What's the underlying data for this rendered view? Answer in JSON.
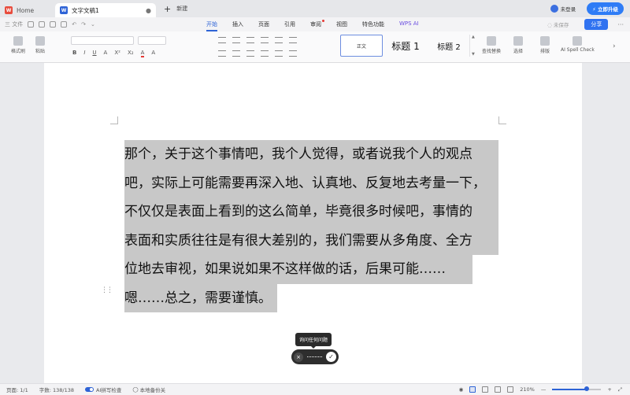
{
  "titlebar": {
    "home_tab": "Home",
    "doc_tab": "文字文稿1",
    "new_tab": "新建",
    "login": "未登录",
    "upgrade": "立即升级"
  },
  "menubar": {
    "quick_file": "三 文件",
    "menus": [
      "开始",
      "插入",
      "页面",
      "引用",
      "审阅",
      "视图",
      "特色功能",
      "WPS AI"
    ],
    "active_menu": "开始",
    "unsaved": "未保存",
    "share": "分享",
    "more": "···"
  },
  "ribbon": {
    "format_painter": "格式刷",
    "paste": "粘贴",
    "format_buttons": [
      "B",
      "I",
      "U",
      "A",
      "X²",
      "X₂",
      "A",
      "A"
    ],
    "styles": {
      "normal": "正文",
      "h1": "标题 1",
      "h2": "标题 2"
    },
    "find_replace": "查找替换",
    "select": "选择",
    "layout": "排版",
    "ai_spell": "AI Spell Check"
  },
  "document": {
    "lines": [
      "那个，关于这个事情吧，我个人觉得，或者说我个人的观点",
      "吧，实际上可能需要再深入地、认真地、反复地去考量一下，",
      "不仅仅是表面上看到的这么简单，毕竟很多时候吧，事情的",
      "表面和实质往往是有很大差别的，我们需要从多角度、全方",
      "位地去审视，如果说如果不这样做的话，后果可能……",
      "嗯……总之，需要谨慎。"
    ],
    "drag_handle": "⋮⋮"
  },
  "ai_widget": {
    "tooltip": "询问任何问题",
    "close": "×",
    "confirm": "✓"
  },
  "statusbar": {
    "page": "页面: 1/1",
    "word_count": "字数: 138/138",
    "ai_check": "AI拼写检查",
    "backup": "本地备份关",
    "zoom": "210%",
    "zoom_minus": "—",
    "zoom_plus": "+"
  },
  "colors": {
    "accent": "#2e63d6",
    "upgrade_bg": "#2e7cf6",
    "selection": "#c8c8c8",
    "wps_logo": "#e84c3d",
    "doc_logo": "#2e63d6"
  }
}
